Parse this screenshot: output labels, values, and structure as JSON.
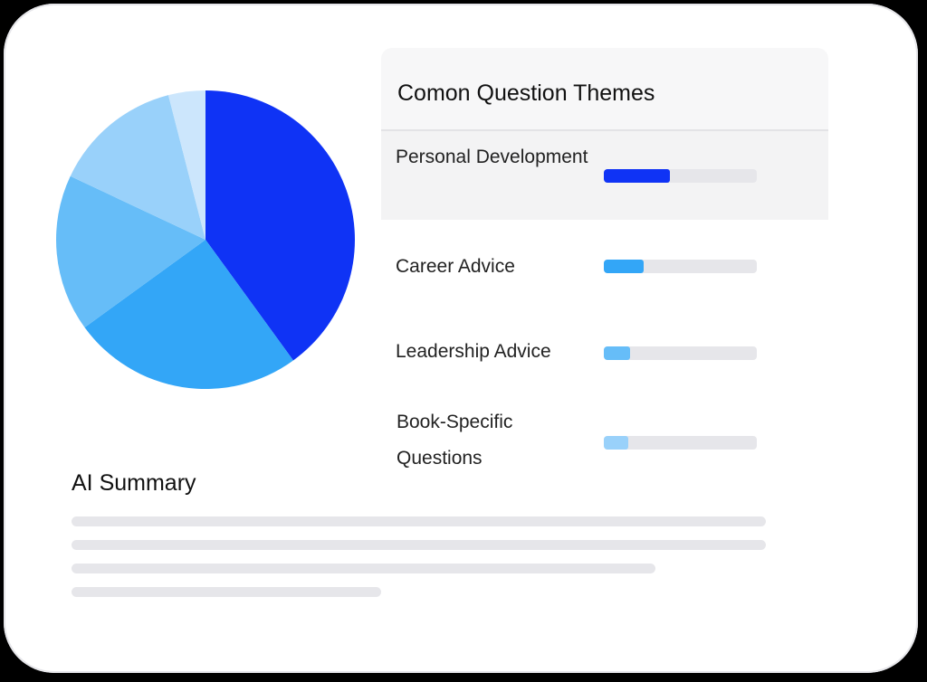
{
  "chart_data": {
    "type": "pie",
    "slices": [
      {
        "value": 40,
        "color": "#0f33f5"
      },
      {
        "value": 25,
        "color": "#33a6f7"
      },
      {
        "value": 17,
        "color": "#66bdf8"
      },
      {
        "value": 14,
        "color": "#99d1fa"
      },
      {
        "value": 4,
        "color": "#cce6fc"
      }
    ]
  },
  "themes": {
    "title": "Comon Question Themes",
    "items": [
      {
        "label": "Personal Development",
        "progress": 0.43,
        "color": "#0f33f5"
      },
      {
        "label": "Career Advice",
        "progress": 0.26,
        "color": "#33a6f7"
      },
      {
        "label": "Leadership Advice",
        "progress": 0.17,
        "color": "#66bdf8"
      },
      {
        "label": "Book-Specific Questions",
        "progress": 0.16,
        "color": "#99d1fa"
      }
    ]
  },
  "summary": {
    "title": "AI Summary"
  }
}
